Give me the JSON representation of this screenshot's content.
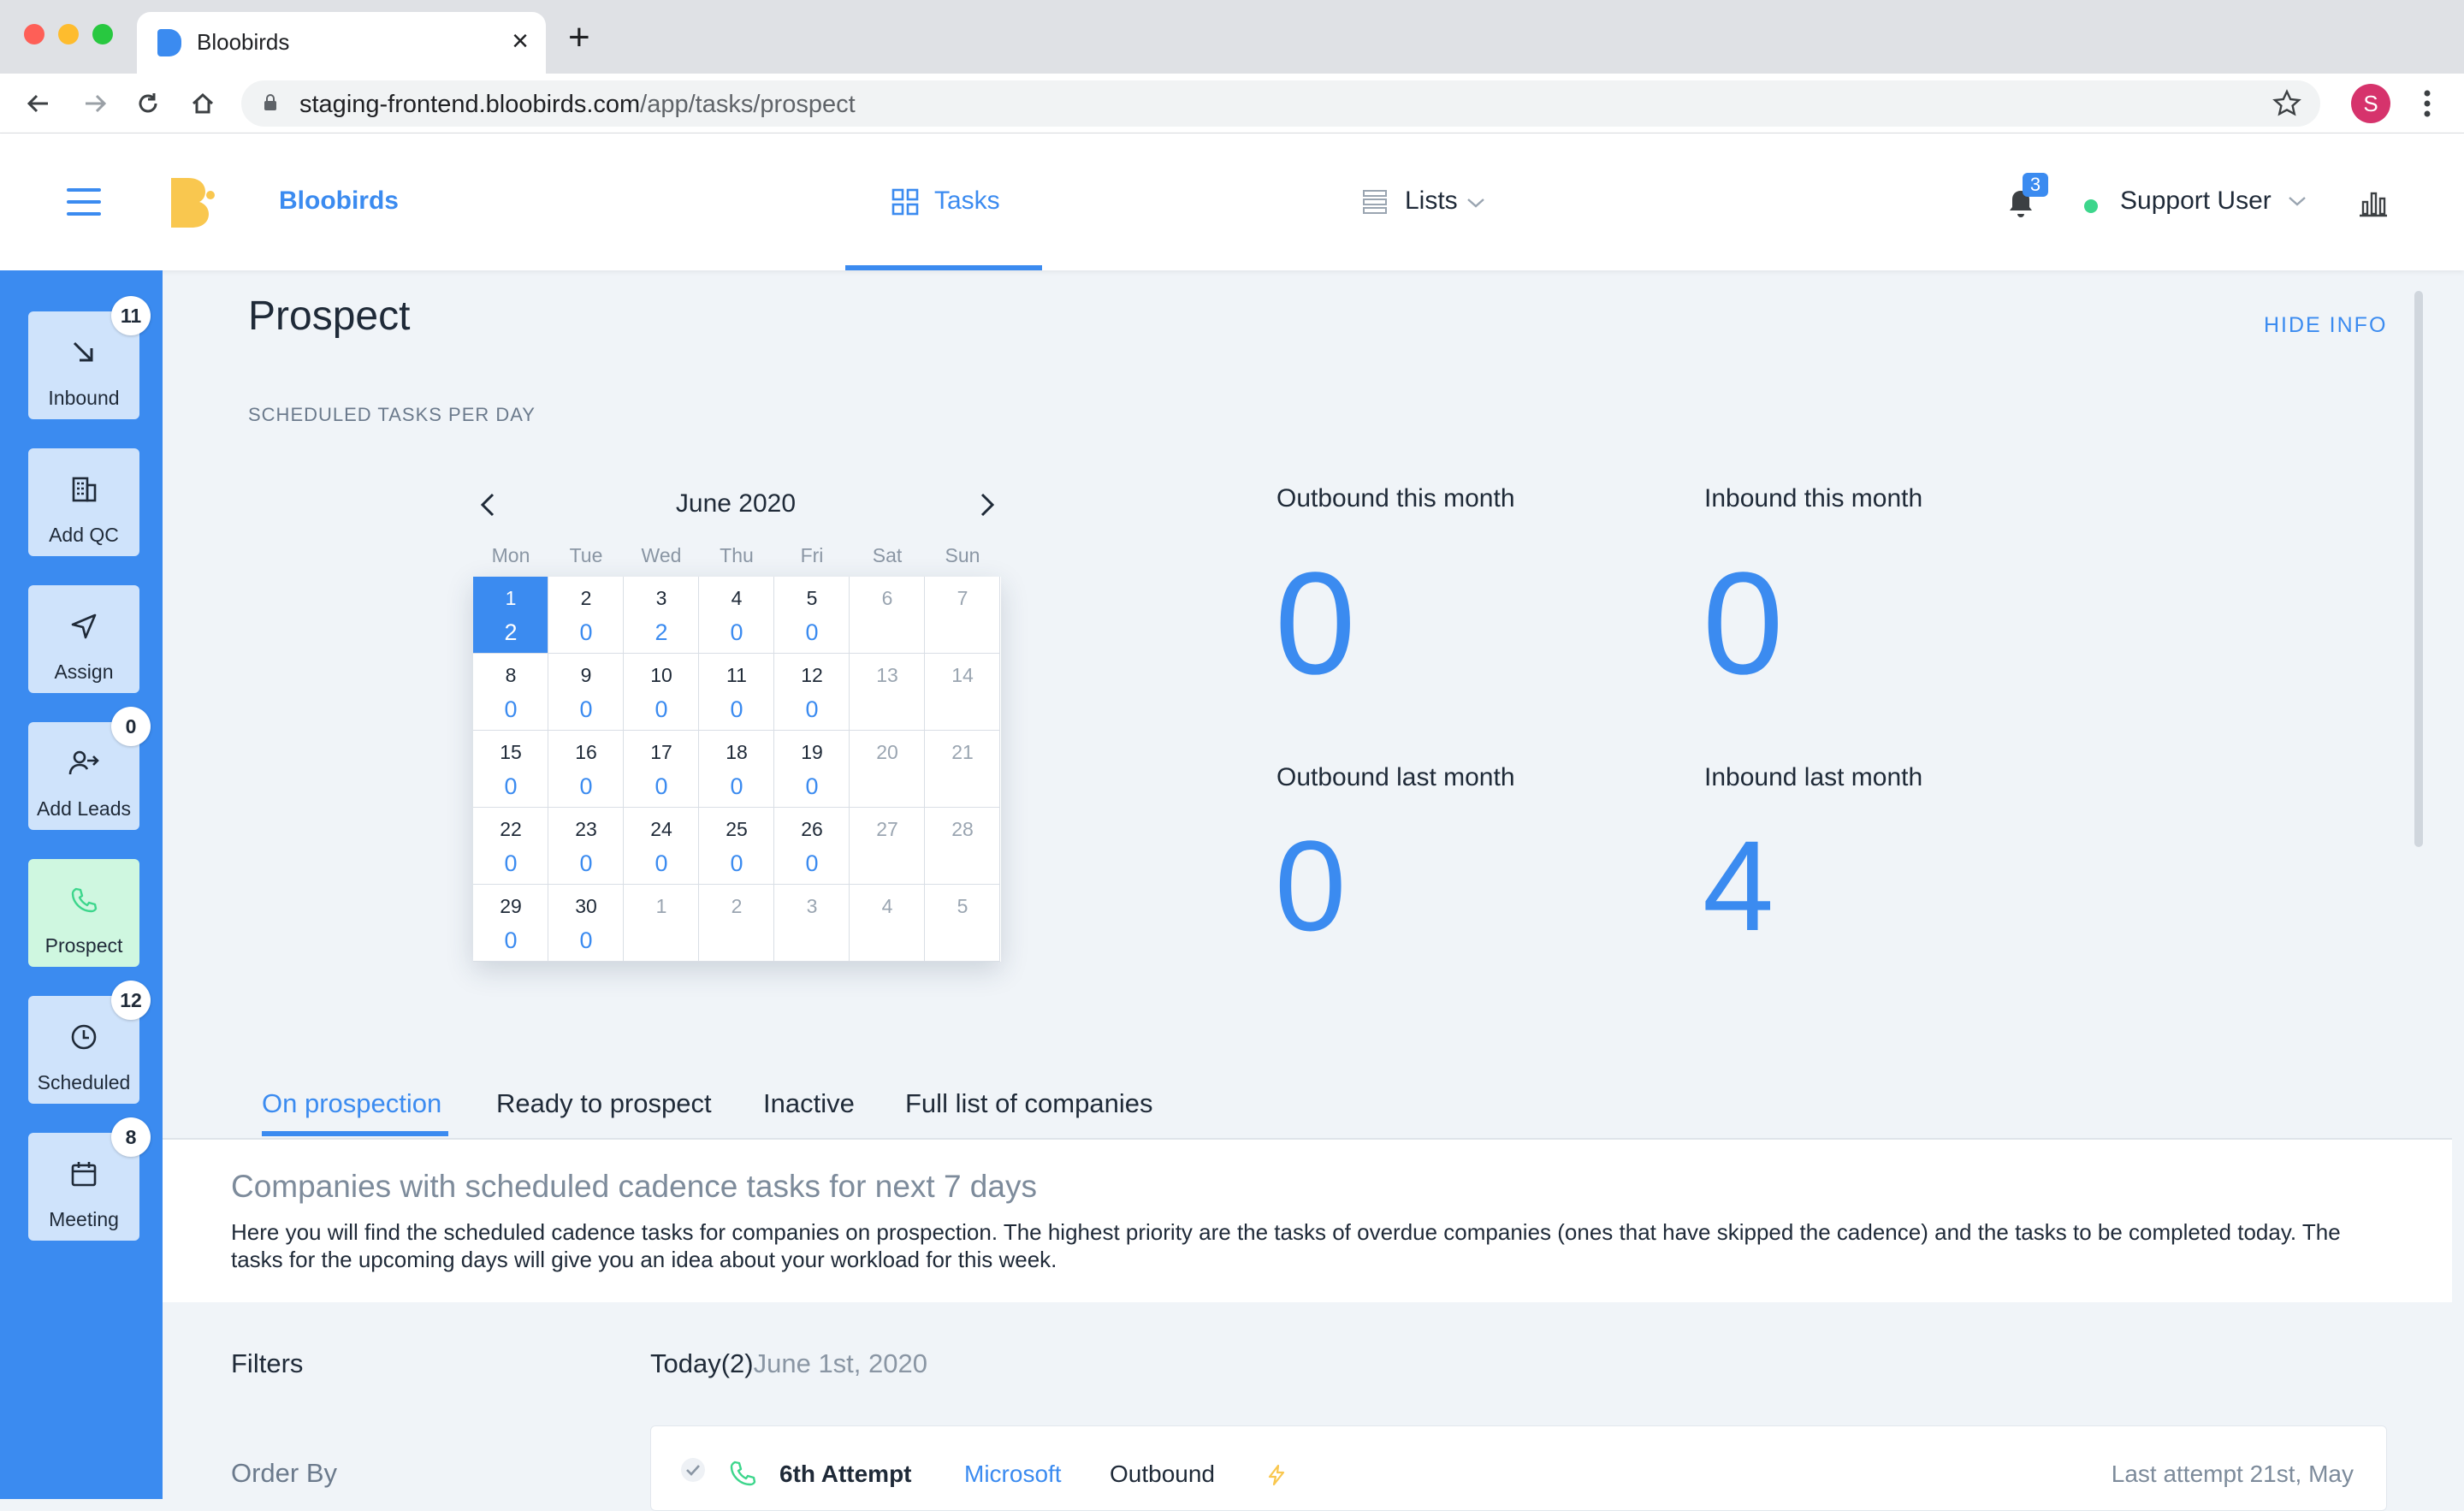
{
  "browser": {
    "tab_title": "Bloobirds",
    "url_host": "staging-frontend.bloobirds.com",
    "url_path": "/app/tasks/prospect",
    "profile_initial": "S"
  },
  "header": {
    "brand": "Bloobirds",
    "nav_tasks": "Tasks",
    "nav_lists": "Lists",
    "notifications_count": "3",
    "user_name": "Support User"
  },
  "sidebar": {
    "items": [
      {
        "label": "Inbound",
        "badge": "11",
        "icon": "arrow-down-right-icon"
      },
      {
        "label": "Add QC",
        "badge": "",
        "icon": "building-icon"
      },
      {
        "label": "Assign",
        "badge": "",
        "icon": "send-icon"
      },
      {
        "label": "Add Leads",
        "badge": "0",
        "icon": "user-arrow-icon"
      },
      {
        "label": "Prospect",
        "badge": "",
        "icon": "phone-icon"
      },
      {
        "label": "Scheduled",
        "badge": "12",
        "icon": "clock-icon"
      },
      {
        "label": "Meeting",
        "badge": "8",
        "icon": "calendar-icon"
      }
    ]
  },
  "page": {
    "title": "Prospect",
    "hide_info": "HIDE INFO",
    "section_label": "SCHEDULED TASKS PER DAY"
  },
  "calendar": {
    "month": "June 2020",
    "weekdays": [
      "Mon",
      "Tue",
      "Wed",
      "Thu",
      "Fri",
      "Sat",
      "Sun"
    ],
    "weeks": [
      [
        {
          "d": "1",
          "n": "2",
          "sel": true
        },
        {
          "d": "2",
          "n": "0"
        },
        {
          "d": "3",
          "n": "2"
        },
        {
          "d": "4",
          "n": "0"
        },
        {
          "d": "5",
          "n": "0"
        },
        {
          "d": "6",
          "n": "",
          "w": true
        },
        {
          "d": "7",
          "n": "",
          "w": true
        }
      ],
      [
        {
          "d": "8",
          "n": "0"
        },
        {
          "d": "9",
          "n": "0"
        },
        {
          "d": "10",
          "n": "0"
        },
        {
          "d": "11",
          "n": "0"
        },
        {
          "d": "12",
          "n": "0"
        },
        {
          "d": "13",
          "n": "",
          "w": true
        },
        {
          "d": "14",
          "n": "",
          "w": true
        }
      ],
      [
        {
          "d": "15",
          "n": "0"
        },
        {
          "d": "16",
          "n": "0"
        },
        {
          "d": "17",
          "n": "0"
        },
        {
          "d": "18",
          "n": "0"
        },
        {
          "d": "19",
          "n": "0"
        },
        {
          "d": "20",
          "n": "",
          "w": true
        },
        {
          "d": "21",
          "n": "",
          "w": true
        }
      ],
      [
        {
          "d": "22",
          "n": "0"
        },
        {
          "d": "23",
          "n": "0"
        },
        {
          "d": "24",
          "n": "0"
        },
        {
          "d": "25",
          "n": "0"
        },
        {
          "d": "26",
          "n": "0"
        },
        {
          "d": "27",
          "n": "",
          "w": true
        },
        {
          "d": "28",
          "n": "",
          "w": true
        }
      ],
      [
        {
          "d": "29",
          "n": "0"
        },
        {
          "d": "30",
          "n": "0"
        },
        {
          "d": "1",
          "n": "",
          "o": true
        },
        {
          "d": "2",
          "n": "",
          "o": true
        },
        {
          "d": "3",
          "n": "",
          "o": true
        },
        {
          "d": "4",
          "n": "",
          "o": true
        },
        {
          "d": "5",
          "n": "",
          "o": true
        }
      ]
    ]
  },
  "stats": {
    "outbound_this_month_label": "Outbound this month",
    "outbound_this_month": "0",
    "inbound_this_month_label": "Inbound this month",
    "inbound_this_month": "0",
    "outbound_last_month_label": "Outbound last month",
    "outbound_last_month": "0",
    "inbound_last_month_label": "Inbound last month",
    "inbound_last_month": "4"
  },
  "tabs": [
    "On prospection",
    "Ready to prospect",
    "Inactive",
    "Full list of companies"
  ],
  "info": {
    "title": "Companies with scheduled cadence tasks for next 7 days",
    "text": "Here you will find the scheduled cadence tasks for companies on prospection. The highest priority are the tasks of overdue companies (ones that have skipped the cadence) and the tasks to be completed today. The tasks for the upcoming days will give you an idea about your workload for this week."
  },
  "filters": {
    "label": "Filters",
    "order_by": "Order By",
    "today": "Today(2)",
    "today_date": "June 1st, 2020"
  },
  "task": {
    "attempt": "6th Attempt",
    "company": "Microsoft",
    "direction": "Outbound",
    "last_attempt": "Last attempt 21st, May"
  },
  "colors": {
    "accent": "#3b8bf0",
    "sidebar_button": "#cfe3fb",
    "active_button": "#cff7e0",
    "brand_logo": "#f9c74f"
  }
}
